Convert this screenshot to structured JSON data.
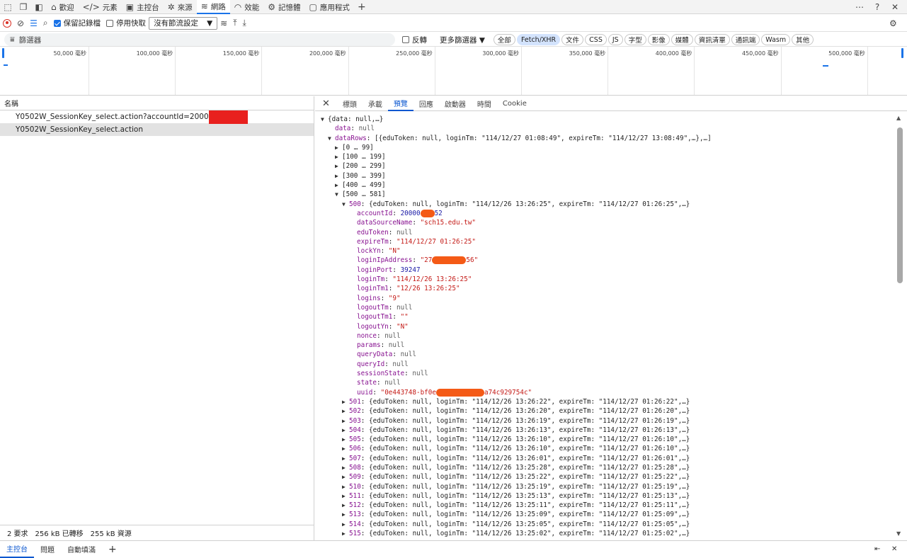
{
  "panel_tabs": [
    {
      "label": "歡迎",
      "icon": "home-icon"
    },
    {
      "label": "元素",
      "icon": "code-icon"
    },
    {
      "label": "主控台",
      "icon": "console-icon"
    },
    {
      "label": "來源",
      "icon": "bug-icon"
    },
    {
      "label": "網路",
      "icon": "wifi-icon"
    },
    {
      "label": "效能",
      "icon": "performance-icon"
    },
    {
      "label": "記憶體",
      "icon": "memory-icon"
    },
    {
      "label": "應用程式",
      "icon": "application-icon"
    }
  ],
  "toolbar": {
    "preserve_log": "保留記錄檔",
    "disable_cache": "停用快取",
    "throttling": "沒有節流設定"
  },
  "filter": {
    "placeholder": "篩選器",
    "invert": "反轉",
    "more_filters": "更多篩選器",
    "types": [
      "全部",
      "Fetch/XHR",
      "文件",
      "CSS",
      "JS",
      "字型",
      "影像",
      "媒體",
      "資訊清單",
      "通訊端",
      "Wasm",
      "其他"
    ],
    "selected": "Fetch/XHR"
  },
  "timeline": {
    "ticks": [
      "50,000 毫秒",
      "100,000 毫秒",
      "150,000 毫秒",
      "200,000 毫秒",
      "250,000 毫秒",
      "300,000 毫秒",
      "350,000 毫秒",
      "400,000 毫秒",
      "450,000 毫秒",
      "500,000 毫秒"
    ]
  },
  "requests": {
    "header": "名稱",
    "items": [
      "Y0502W_SessionKey_select.action?accountId=2000",
      "Y0502W_SessionKey_select.action"
    ]
  },
  "status": {
    "requests": "2 要求",
    "transferred": "256 kB 已轉移",
    "resources": "255 kB 資源"
  },
  "detail_tabs": [
    "標頭",
    "承載",
    "預覽",
    "回應",
    "啟動器",
    "時間",
    "Cookie"
  ],
  "detail_active": "預覽",
  "preview": {
    "root": "{data: null,…}",
    "data_key": "data",
    "data_val": "null",
    "datarows_key": "dataRows",
    "datarows_summary": "[{eduToken: null, loginTm: \"114/12/27 01:08:49\", expireTm: \"114/12/27 13:08:49\",…},…]",
    "ranges": [
      "[0 … 99]",
      "[100 … 199]",
      "[200 … 299]",
      "[300 … 399]",
      "[400 … 499]",
      "[500 … 581]"
    ],
    "item500_key": "500",
    "item500_summary": "{eduToken: null, loginTm: \"114/12/26 13:26:25\", expireTm: \"114/12/27 01:26:25\",…}",
    "fields": [
      {
        "k": "accountId",
        "v": "20000",
        "t": "n",
        "redact": true,
        "tail": "52"
      },
      {
        "k": "dataSourceName",
        "v": "\"sch15.edu.tw\"",
        "t": "s"
      },
      {
        "k": "eduToken",
        "v": "null",
        "t": "nul"
      },
      {
        "k": "expireTm",
        "v": "\"114/12/27 01:26:25\"",
        "t": "s"
      },
      {
        "k": "lockYn",
        "v": "\"N\"",
        "t": "s"
      },
      {
        "k": "loginIpAddress",
        "v": "\"27",
        "t": "s",
        "redact": true,
        "tail": "56\""
      },
      {
        "k": "loginPort",
        "v": "39247",
        "t": "n"
      },
      {
        "k": "loginTm",
        "v": "\"114/12/26 13:26:25\"",
        "t": "s"
      },
      {
        "k": "loginTm1",
        "v": "\"12/26 13:26:25\"",
        "t": "s"
      },
      {
        "k": "logins",
        "v": "\"9\"",
        "t": "s"
      },
      {
        "k": "logoutTm",
        "v": "null",
        "t": "nul"
      },
      {
        "k": "logoutTm1",
        "v": "\"\"",
        "t": "s"
      },
      {
        "k": "logoutYn",
        "v": "\"N\"",
        "t": "s"
      },
      {
        "k": "nonce",
        "v": "null",
        "t": "nul"
      },
      {
        "k": "params",
        "v": "null",
        "t": "nul"
      },
      {
        "k": "queryData",
        "v": "null",
        "t": "nul"
      },
      {
        "k": "queryId",
        "v": "null",
        "t": "nul"
      },
      {
        "k": "sessionState",
        "v": "null",
        "t": "nul"
      },
      {
        "k": "state",
        "v": "null",
        "t": "nul"
      },
      {
        "k": "uuid",
        "v": "\"0e443748-bf0e",
        "t": "s",
        "redact": true,
        "tail": "a74c929754c\""
      }
    ],
    "items": [
      {
        "k": "501",
        "v": "{eduToken: null, loginTm: \"114/12/26 13:26:22\", expireTm: \"114/12/27 01:26:22\",…}"
      },
      {
        "k": "502",
        "v": "{eduToken: null, loginTm: \"114/12/26 13:26:20\", expireTm: \"114/12/27 01:26:20\",…}"
      },
      {
        "k": "503",
        "v": "{eduToken: null, loginTm: \"114/12/26 13:26:19\", expireTm: \"114/12/27 01:26:19\",…}"
      },
      {
        "k": "504",
        "v": "{eduToken: null, loginTm: \"114/12/26 13:26:13\", expireTm: \"114/12/27 01:26:13\",…}"
      },
      {
        "k": "505",
        "v": "{eduToken: null, loginTm: \"114/12/26 13:26:10\", expireTm: \"114/12/27 01:26:10\",…}"
      },
      {
        "k": "506",
        "v": "{eduToken: null, loginTm: \"114/12/26 13:26:10\", expireTm: \"114/12/27 01:26:10\",…}"
      },
      {
        "k": "507",
        "v": "{eduToken: null, loginTm: \"114/12/26 13:26:01\", expireTm: \"114/12/27 01:26:01\",…}"
      },
      {
        "k": "508",
        "v": "{eduToken: null, loginTm: \"114/12/26 13:25:28\", expireTm: \"114/12/27 01:25:28\",…}"
      },
      {
        "k": "509",
        "v": "{eduToken: null, loginTm: \"114/12/26 13:25:22\", expireTm: \"114/12/27 01:25:22\",…}"
      },
      {
        "k": "510",
        "v": "{eduToken: null, loginTm: \"114/12/26 13:25:19\", expireTm: \"114/12/27 01:25:19\",…}"
      },
      {
        "k": "511",
        "v": "{eduToken: null, loginTm: \"114/12/26 13:25:13\", expireTm: \"114/12/27 01:25:13\",…}"
      },
      {
        "k": "512",
        "v": "{eduToken: null, loginTm: \"114/12/26 13:25:11\", expireTm: \"114/12/27 01:25:11\",…}"
      },
      {
        "k": "513",
        "v": "{eduToken: null, loginTm: \"114/12/26 13:25:09\", expireTm: \"114/12/27 01:25:09\",…}"
      },
      {
        "k": "514",
        "v": "{eduToken: null, loginTm: \"114/12/26 13:25:05\", expireTm: \"114/12/27 01:25:05\",…}"
      },
      {
        "k": "515",
        "v": "{eduToken: null, loginTm: \"114/12/26 13:25:02\", expireTm: \"114/12/27 01:25:02\",…}"
      }
    ]
  },
  "drawer_tabs": [
    "主控台",
    "問題",
    "自動填滿"
  ],
  "drawer_active": "主控台"
}
